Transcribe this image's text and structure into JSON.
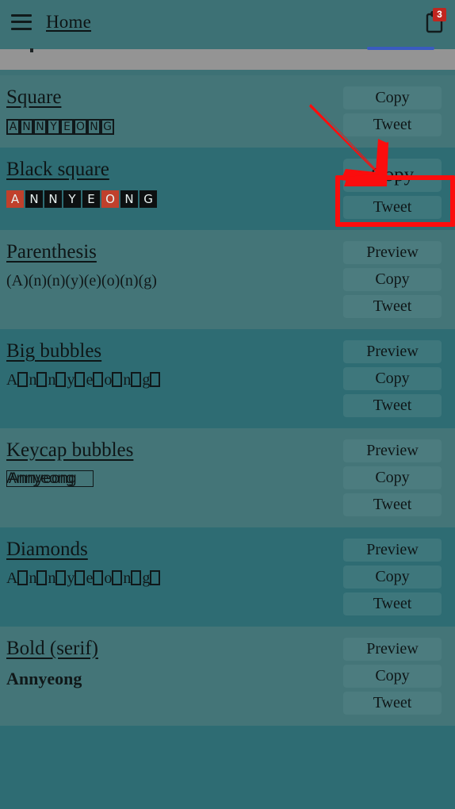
{
  "header": {
    "menu_icon": "hamburger-menu-icon",
    "home_label": "Home",
    "clipboard_icon": "clipboard-icon",
    "clipboard_badge": "3"
  },
  "colors": {
    "header_bg": "#3d7175",
    "row_light": "#447578",
    "row_dark": "#2e6c73",
    "button_bg": "#4c7c7f",
    "highlight_button_bg": "#7bc8d8",
    "annotation_red": "#fb0d0d",
    "badge_red": "#c0261f",
    "blue_underline": "#3a5bbf"
  },
  "annotation": {
    "arrow_icon": "red-arrow-down-right-icon",
    "target": "Copy"
  },
  "buttons": {
    "preview": "Preview",
    "copy": "Copy",
    "tweet": "Tweet"
  },
  "rows": [
    {
      "title": "Square",
      "sample_chars": [
        "A",
        "N",
        "N",
        "Y",
        "E",
        "O",
        "N",
        "G"
      ],
      "actions": [
        "Copy",
        "Tweet"
      ]
    },
    {
      "title": "Black square",
      "sample_chars": [
        "A",
        "N",
        "N",
        "Y",
        "E",
        "O",
        "N",
        "G"
      ],
      "vowel_indexes": [
        0,
        5
      ],
      "actions": [
        "Copy",
        "Tweet"
      ]
    },
    {
      "title": "Parenthesis",
      "sample_text": "(A)(n)(n)(y)(e)(o)(n)(g)",
      "actions": [
        "Preview",
        "Copy",
        "Tweet"
      ]
    },
    {
      "title": "Big bubbles",
      "sample_letters": [
        "A",
        "n",
        "n",
        "y",
        "e",
        "o",
        "n",
        "g"
      ],
      "actions": [
        "Preview",
        "Copy",
        "Tweet"
      ]
    },
    {
      "title": "Keycap bubbles",
      "sample_text_a": "Annyeong",
      "sample_text_b": "Annyeong",
      "actions": [
        "Preview",
        "Copy",
        "Tweet"
      ]
    },
    {
      "title": "Diamonds",
      "sample_letters": [
        "A",
        "n",
        "n",
        "y",
        "e",
        "o",
        "n",
        "g"
      ],
      "actions": [
        "Preview",
        "Copy",
        "Tweet"
      ]
    },
    {
      "title": "Bold (serif)",
      "sample_text": "Annyeong",
      "actions": [
        "Preview",
        "Copy",
        "Tweet"
      ]
    }
  ]
}
